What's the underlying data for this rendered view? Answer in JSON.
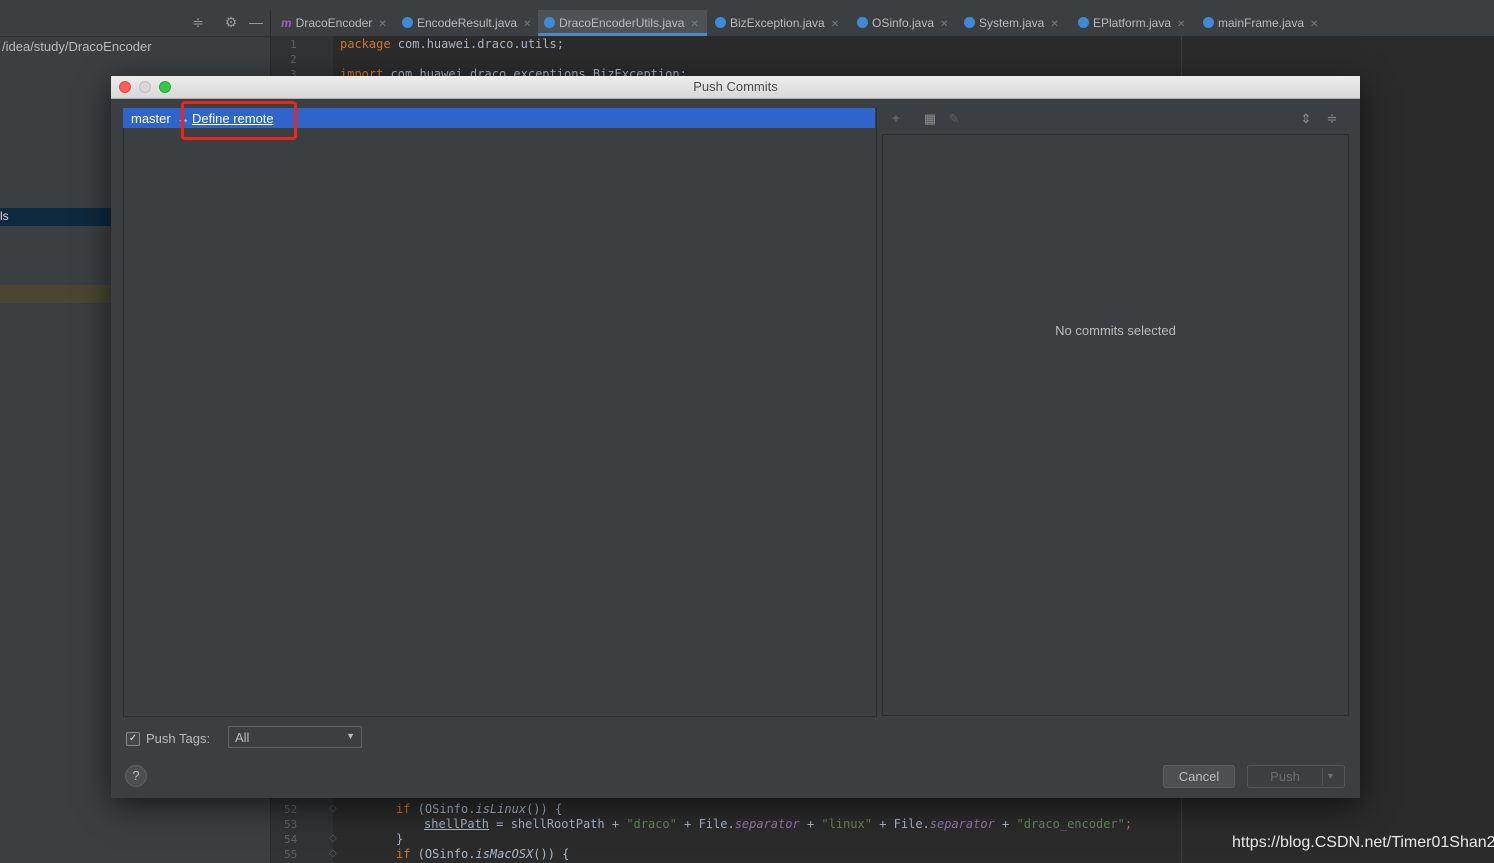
{
  "ide": {
    "project_path": "/idea/study/DracoEncoder",
    "selected_row_text": "ls",
    "tabs": [
      {
        "label": "DracoEncoder",
        "icon": "maven-icon",
        "color": "#a35ac4"
      },
      {
        "label": "EncodeResult.java",
        "icon": "class-icon",
        "color": "#3d8bd6"
      },
      {
        "label": "DracoEncoderUtils.java",
        "icon": "class-icon",
        "color": "#3d8bd6"
      },
      {
        "label": "BizException.java",
        "icon": "exception-icon",
        "color": "#3d8bd6"
      },
      {
        "label": "OSinfo.java",
        "icon": "class-icon",
        "color": "#3d8bd6"
      },
      {
        "label": "System.java",
        "icon": "class-icon",
        "color": "#3d8bd6"
      },
      {
        "label": "EPlatform.java",
        "icon": "enum-icon",
        "color": "#3d8bd6"
      },
      {
        "label": "mainFrame.java",
        "icon": "class-icon",
        "color": "#3d8bd6"
      }
    ],
    "code_top": {
      "ln1": "1",
      "ln2": "2",
      "ln3": "3",
      "line1_kw": "package",
      "line1_rest": " com.huawei.draco.utils;",
      "line3_kw": "import",
      "line3_rest": " com.huawei.draco.exceptions.BizException;"
    },
    "code_bottom": {
      "ln52": "52",
      "ln53": "53",
      "ln54": "54",
      "ln55": "55",
      "l52_kw": "if",
      "l52_a": " (OSinfo.",
      "l52_m": "isLinux",
      "l52_b": "()) {",
      "l53_var": "shellPath",
      "l53_a": " = shellRootPath + ",
      "l53_s1": "\"draco\"",
      "l53_b": " + File.",
      "l53_f1": "separator",
      "l53_c": " + ",
      "l53_s2": "\"linux\"",
      "l53_d": " + File.",
      "l53_f2": "separator",
      "l53_e": " + ",
      "l53_s3": "\"draco_encoder\"",
      "l53_end": ";",
      "l54": "}",
      "l55_kw": "if",
      "l55_a": " (OSinfo.",
      "l55_m": "isMacOSX",
      "l55_b": "()) {"
    },
    "watermark": "https://blog.CSDN.net/Timer01Shan2"
  },
  "dialog": {
    "title": "Push Commits",
    "branch": "master",
    "branch_arrow": "→",
    "define_remote_label": "Define remote",
    "no_commits_text": "No commits selected",
    "push_tags_label": "Push Tags:",
    "push_tags_checked": true,
    "push_tags_value": "All",
    "help_label": "?",
    "cancel_label": "Cancel",
    "push_label": "Push",
    "colors": {
      "selection": "#2f65ca",
      "highlight_box": "#e8271d",
      "close": "#fc605c",
      "minimize": "#d7d7d7",
      "zoom": "#34c84a"
    }
  }
}
